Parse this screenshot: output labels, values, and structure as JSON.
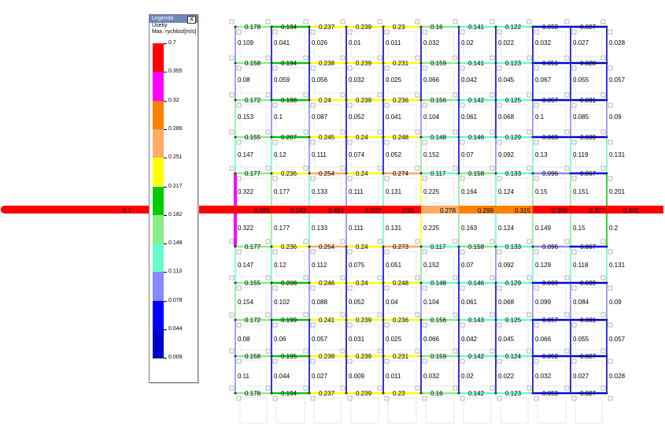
{
  "legend": {
    "title": "Legenda",
    "close_label": "X",
    "subtitle": "Useky",
    "quantity": "Max. rychlost[m/s]",
    "entries": [
      {
        "label": "0.7",
        "color": "#ff0000"
      },
      {
        "label": "0.355",
        "color": "#ff00ff"
      },
      {
        "label": "0.32",
        "color": "#ff8000"
      },
      {
        "label": "0.286",
        "color": "#ffaa66"
      },
      {
        "label": "0.251",
        "color": "#ffff00"
      },
      {
        "label": "0.217",
        "color": "#00cc00"
      },
      {
        "label": "0.182",
        "color": "#88ee88"
      },
      {
        "label": "0.148",
        "color": "#66ffcc"
      },
      {
        "label": "0.113",
        "color": "#8888ff"
      },
      {
        "label": "0.078",
        "color": "#0000ff"
      },
      {
        "label": "0.044",
        "color": "#0000cc"
      },
      {
        "label": "0.009",
        "color": "#000080"
      }
    ]
  },
  "network": {
    "main_pipe_inlet_value": "0.7",
    "main_pipe_outlet_value": "0.402",
    "main_pipe_segments": [
      "0.599",
      "0.543",
      "0.491",
      "0.507",
      "0.55",
      "0.278",
      "0.299",
      "0.315",
      "0.358",
      "0.377"
    ],
    "horizontal_rows": [
      {
        "values": [
          "0.178",
          "0.194",
          "0.237",
          "0.239",
          "0.23",
          "0.16",
          "0.141",
          "0.122",
          "0.053",
          "0.027"
        ]
      },
      {
        "values": [
          "0.158",
          "0.194",
          "0.238",
          "0.239",
          "0.231",
          "0.159",
          "0.141",
          "0.123",
          "0.051",
          "0.028"
        ]
      },
      {
        "values": [
          "0.172",
          "0.198",
          "0.24",
          "0.239",
          "0.236",
          "0.156",
          "0.142",
          "0.125",
          "0.057",
          "0.031"
        ]
      },
      {
        "values": [
          "0.155",
          "0.207",
          "0.245",
          "0.24",
          "0.248",
          "0.148",
          "0.146",
          "0.129",
          "0.069",
          "0.039"
        ]
      },
      {
        "values": [
          "0.177",
          "0.236",
          "0.254",
          "0.24",
          "0.274",
          "0.117",
          "0.158",
          "0.133",
          "0.096",
          "0.067"
        ]
      },
      {
        "values": [
          "0.177",
          "0.236",
          "0.254",
          "0.24",
          "0.273",
          "0.117",
          "0.158",
          "0.133",
          "0.096",
          "0.067"
        ]
      },
      {
        "values": [
          "0.155",
          "0.208",
          "0.246",
          "0.24",
          "0.248",
          "0.148",
          "0.146",
          "0.129",
          "0.069",
          "0.039"
        ]
      },
      {
        "values": [
          "0.172",
          "0.199",
          "0.241",
          "0.239",
          "0.236",
          "0.156",
          "0.143",
          "0.125",
          "0.057",
          "0.031"
        ]
      },
      {
        "values": [
          "0.158",
          "0.195",
          "0.238",
          "0.239",
          "0.231",
          "0.159",
          "0.142",
          "0.124",
          "0.052",
          "0.027"
        ]
      },
      {
        "values": [
          "0.178",
          "0.194",
          "0.237",
          "0.239",
          "0.23",
          "0.16",
          "0.142",
          "0.123",
          "0.053",
          "0.027"
        ]
      }
    ],
    "vertical_rows": [
      {
        "values": [
          "0.109",
          "0.041",
          "0.026",
          "0.01",
          "0.011",
          "0.032",
          "0.02",
          "0.022",
          "0.032",
          "0.027",
          "0.028"
        ]
      },
      {
        "values": [
          "0.08",
          "0.059",
          "0.056",
          "0.032",
          "0.025",
          "0.066",
          "0.042",
          "0.045",
          "0.067",
          "0.055",
          "0.057"
        ]
      },
      {
        "values": [
          "0.153",
          "0.1",
          "0.087",
          "0.052",
          "0.041",
          "0.104",
          "0.061",
          "0.068",
          "0.1",
          "0.085",
          "0.09"
        ]
      },
      {
        "values": [
          "0.147",
          "0.12",
          "0.111",
          "0.074",
          "0.052",
          "0.152",
          "0.07",
          "0.092",
          "0.13",
          "0.119",
          "0.131"
        ]
      },
      {
        "values": [
          "0.322",
          "0.177",
          "0.133",
          "0.111",
          "0.131",
          "0.225",
          "0.164",
          "0.124",
          "0.15",
          "0.151",
          "0.201"
        ]
      },
      {
        "values": [
          "0.322",
          "0.177",
          "0.133",
          "0.111",
          "0.131",
          "0.225",
          "0.163",
          "0.124",
          "0.149",
          "0.15",
          "0.2"
        ]
      },
      {
        "values": [
          "0.147",
          "0.12",
          "0.112",
          "0.075",
          "0.051",
          "0.152",
          "0.07",
          "0.092",
          "0.129",
          "0.118",
          "0.131"
        ]
      },
      {
        "values": [
          "0.154",
          "0.102",
          "0.088",
          "0.052",
          "0.04",
          "0.104",
          "0.061",
          "0.068",
          "0.099",
          "0.084",
          "0.09"
        ]
      },
      {
        "values": [
          "0.08",
          "0.06",
          "0.057",
          "0.031",
          "0.025",
          "0.066",
          "0.042",
          "0.045",
          "0.066",
          "0.055",
          "0.057"
        ]
      },
      {
        "values": [
          "0.11",
          "0.044",
          "0.027",
          "0.009",
          "0.011",
          "0.032",
          "0.02",
          "0.022",
          "0.032",
          "0.027",
          "0.028"
        ]
      }
    ]
  }
}
